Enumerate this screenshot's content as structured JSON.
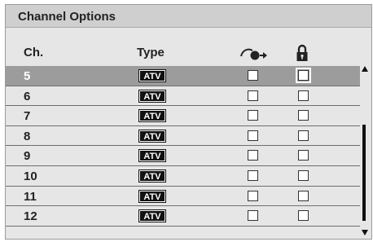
{
  "title": "Channel Options",
  "columns": {
    "ch": "Ch.",
    "type": "Type",
    "skip_icon": "skip-icon",
    "lock_icon": "lock-icon"
  },
  "rows": [
    {
      "ch": "5",
      "type": "ATV",
      "selected": true,
      "skip": false,
      "lock": false
    },
    {
      "ch": "6",
      "type": "ATV",
      "selected": false,
      "skip": false,
      "lock": false
    },
    {
      "ch": "7",
      "type": "ATV",
      "selected": false,
      "skip": false,
      "lock": false
    },
    {
      "ch": "8",
      "type": "ATV",
      "selected": false,
      "skip": false,
      "lock": false
    },
    {
      "ch": "9",
      "type": "ATV",
      "selected": false,
      "skip": false,
      "lock": false
    },
    {
      "ch": "10",
      "type": "ATV",
      "selected": false,
      "skip": false,
      "lock": false
    },
    {
      "ch": "11",
      "type": "ATV",
      "selected": false,
      "skip": false,
      "lock": false
    },
    {
      "ch": "12",
      "type": "ATV",
      "selected": false,
      "skip": false,
      "lock": false
    }
  ],
  "colors": {
    "panel": "#e6e6e6",
    "title_bar": "#cfcfcf",
    "selected_row": "#9c9c9c",
    "badge": "#111111"
  }
}
